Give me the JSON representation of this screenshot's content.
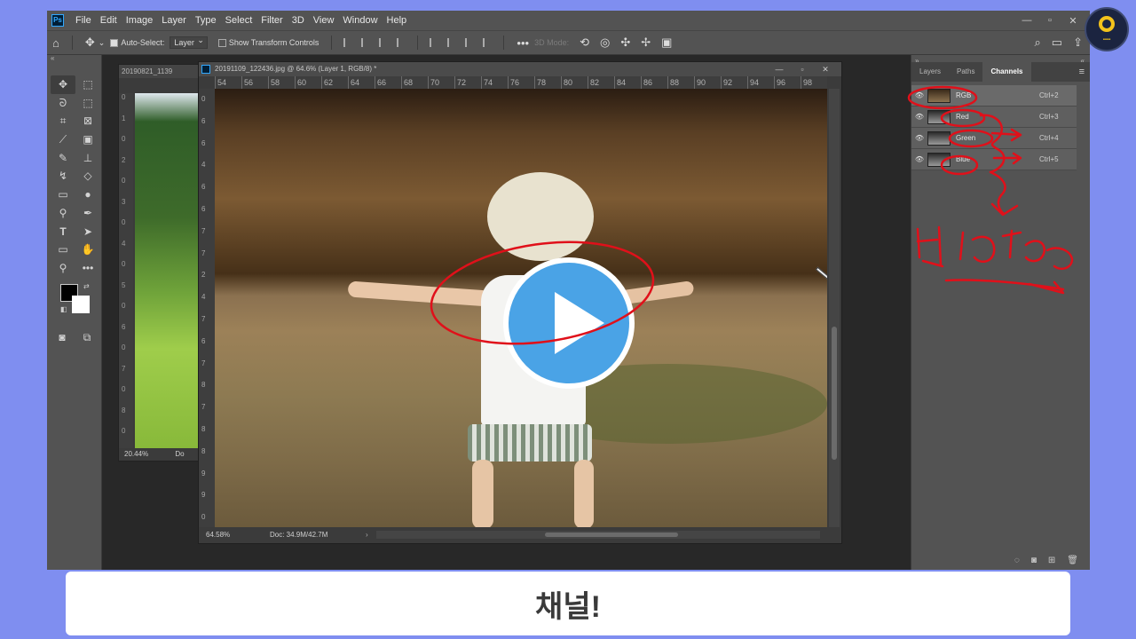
{
  "menubar": {
    "items": [
      "File",
      "Edit",
      "Image",
      "Layer",
      "Type",
      "Select",
      "Filter",
      "3D",
      "View",
      "Window",
      "Help"
    ],
    "logo": "Ps"
  },
  "options": {
    "auto_select_label": "Auto-Select:",
    "auto_select_value": "Layer",
    "show_transform_label": "Show Transform Controls",
    "mode_3d_label": "3D Mode:"
  },
  "doc_back": {
    "title": "20190821_1139",
    "zoom": "20.44%",
    "doc_label": "Do",
    "ruler_v": [
      "0",
      "1",
      "0",
      "2",
      "0",
      "3",
      "0",
      "4",
      "0",
      "5",
      "0",
      "6",
      "0",
      "7",
      "0",
      "8",
      "0"
    ]
  },
  "doc_main": {
    "title": "20191109_122436.jpg @ 64.6% (Layer 1, RGB/8) *",
    "ruler_h": [
      "54",
      "56",
      "58",
      "60",
      "62",
      "64",
      "66",
      "68",
      "70",
      "72",
      "74",
      "76",
      "78",
      "80",
      "82",
      "84",
      "86",
      "88",
      "90",
      "92",
      "94",
      "96",
      "98"
    ],
    "ruler_v": [
      "0",
      "6",
      "6",
      "4",
      "6",
      "6",
      "7",
      "7",
      "2",
      "4",
      "7",
      "6",
      "7",
      "8",
      "7",
      "8",
      "8",
      "9",
      "9",
      "0"
    ],
    "zoom": "64.58%",
    "doc_info": "Doc: 34.9M/42.7M"
  },
  "panel": {
    "tabs": [
      "Layers",
      "Paths",
      "Channels"
    ],
    "active_tab": "Channels",
    "channels": [
      {
        "name": "RGB",
        "shortcut": "Ctrl+2"
      },
      {
        "name": "Red",
        "shortcut": "Ctrl+3"
      },
      {
        "name": "Green",
        "shortcut": "Ctrl+4"
      },
      {
        "name": "Blue",
        "shortcut": "Ctrl+5"
      }
    ]
  },
  "caption": "채널!",
  "colors": {
    "annotation_red": "#e0101a",
    "play_blue": "#4aa3e6",
    "frame_bg": "#7f8ef0"
  }
}
